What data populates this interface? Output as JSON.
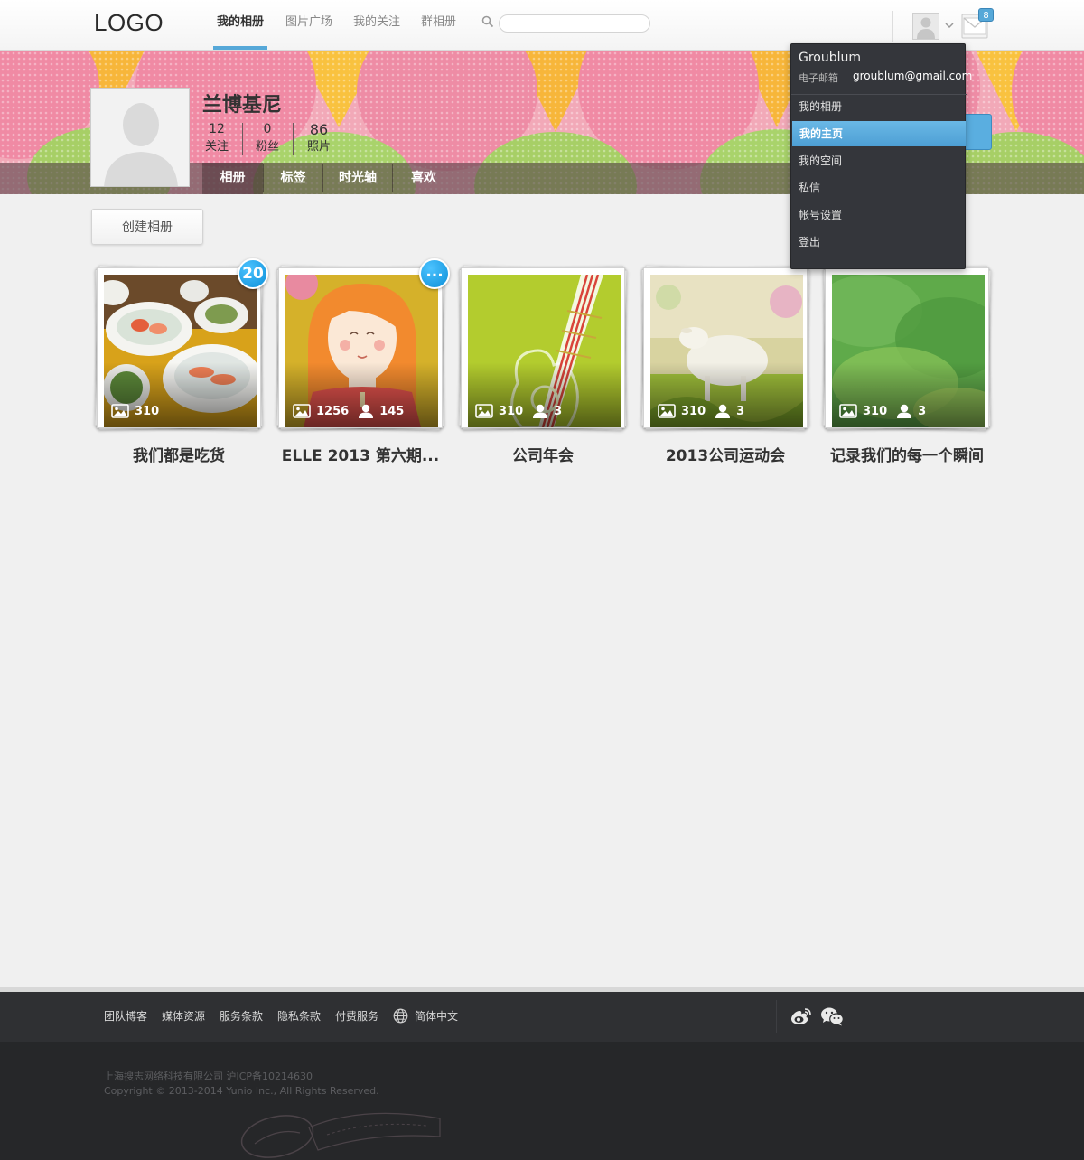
{
  "topbar": {
    "logo": "LOGO",
    "tabs": [
      {
        "label": "我的相册",
        "active": true
      },
      {
        "label": "图片广场",
        "active": false
      },
      {
        "label": "我的关注",
        "active": false
      },
      {
        "label": "群相册",
        "active": false
      }
    ],
    "search": {
      "value": "",
      "placeholder": ""
    },
    "mail_count": "8"
  },
  "profile": {
    "name": "兰博基尼",
    "stats": [
      {
        "value": "12",
        "label": "关注"
      },
      {
        "value": "0",
        "label": "粉丝"
      },
      {
        "value": "86",
        "label": "照片"
      }
    ],
    "tabs": [
      {
        "label": "相册",
        "active": true
      },
      {
        "label": "标签",
        "active": false
      },
      {
        "label": "时光轴",
        "active": false
      },
      {
        "label": "喜欢",
        "active": false
      }
    ]
  },
  "main": {
    "create_album_label": "创建相册",
    "albums": [
      {
        "title": "我们都是吃货",
        "photos": "310",
        "members": "",
        "badge": "20",
        "theme": "food"
      },
      {
        "title": "ELLE 2013 第六期...",
        "photos": "1256",
        "members": "145",
        "badge": "...",
        "theme": "girl"
      },
      {
        "title": "公司年会",
        "photos": "310",
        "members": "3",
        "badge": "",
        "theme": "guitar"
      },
      {
        "title": "2013公司运动会",
        "photos": "310",
        "members": "3",
        "badge": "",
        "theme": "sheep"
      },
      {
        "title": "记录我们的每一个瞬间",
        "photos": "310",
        "members": "3",
        "badge": "",
        "theme": "green"
      }
    ]
  },
  "dropdown": {
    "username": "Groublum",
    "email_label": "电子邮箱",
    "email": "groublum@gmail.com",
    "items": [
      {
        "label": "我的相册",
        "active": false
      },
      {
        "label": "我的主页",
        "active": true
      },
      {
        "label": "我的空间",
        "active": false
      },
      {
        "label": "私信",
        "active": false
      },
      {
        "label": "帐号设置",
        "active": false
      },
      {
        "label": "登出",
        "active": false
      }
    ]
  },
  "footer": {
    "links": [
      "团队博客",
      "媒体资源",
      "服务条款",
      "隐私条款",
      "付费服务"
    ],
    "language": "简体中文",
    "company_line": "上海搜志网络科技有限公司  沪ICP备10214630",
    "copyright": "Copyright © 2013-2014 Yunio Inc., All Rights Reserved."
  },
  "colors": {
    "accent_blue": "#56a8d8",
    "badge_blue": "#0d8fd8",
    "dropdown_bg": "#34363b",
    "footer_bg": "#2f3033"
  },
  "icons": [
    "search-icon",
    "chevron-down-icon",
    "mail-icon",
    "image-icon",
    "user-icon",
    "globe-icon",
    "weibo-icon",
    "wechat-icon"
  ]
}
